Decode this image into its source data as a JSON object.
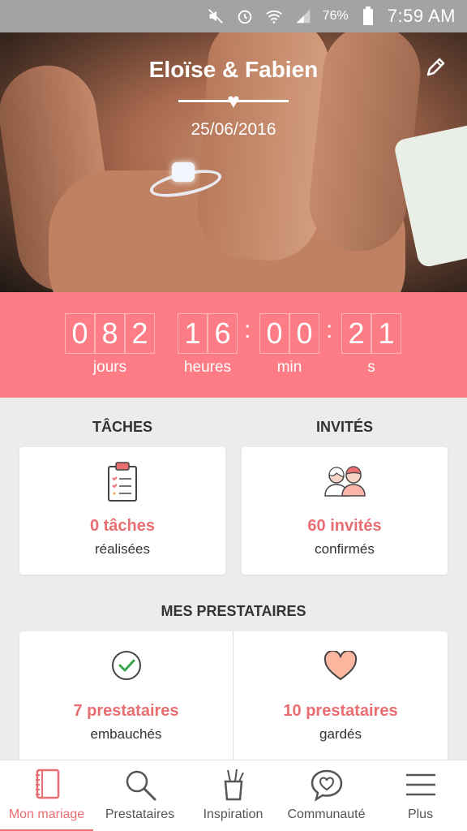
{
  "status_bar": {
    "battery": "76%",
    "time": "7:59 AM",
    "icons": [
      "mute-icon",
      "alarm-icon",
      "wifi-icon",
      "signal-icon",
      "battery-icon"
    ]
  },
  "hero": {
    "couple": "Eloïse & Fabien",
    "date": "25/06/2016"
  },
  "countdown": {
    "days": [
      "0",
      "8",
      "2"
    ],
    "hours": [
      "1",
      "6"
    ],
    "minutes": [
      "0",
      "0"
    ],
    "seconds": [
      "2",
      "1"
    ],
    "labels": {
      "days": "jours",
      "hours": "heures",
      "minutes": "min",
      "seconds": "s"
    }
  },
  "tasks": {
    "heading": "TÂCHES",
    "value": "0 tâches",
    "caption": "réalisées"
  },
  "guests": {
    "heading": "INVITÉS",
    "value": "60 invités",
    "caption": "confirmés"
  },
  "vendors": {
    "heading": "MES PRESTATAIRES",
    "hired": {
      "value": "7 prestataires",
      "caption": "embauchés"
    },
    "saved": {
      "value": "10 prestataires",
      "caption": "gardés"
    }
  },
  "nav": {
    "items": [
      {
        "label": "Mon mariage",
        "icon": "notebook-icon",
        "active": true
      },
      {
        "label": "Prestataires",
        "icon": "search-icon",
        "active": false
      },
      {
        "label": "Inspiration",
        "icon": "pencil-cup-icon",
        "active": false
      },
      {
        "label": "Communauté",
        "icon": "chat-heart-icon",
        "active": false
      },
      {
        "label": "Plus",
        "icon": "menu-icon",
        "active": false
      }
    ]
  },
  "colors": {
    "accent": "#fd7c86",
    "accent_text": "#e96e72",
    "background": "#ececec"
  }
}
